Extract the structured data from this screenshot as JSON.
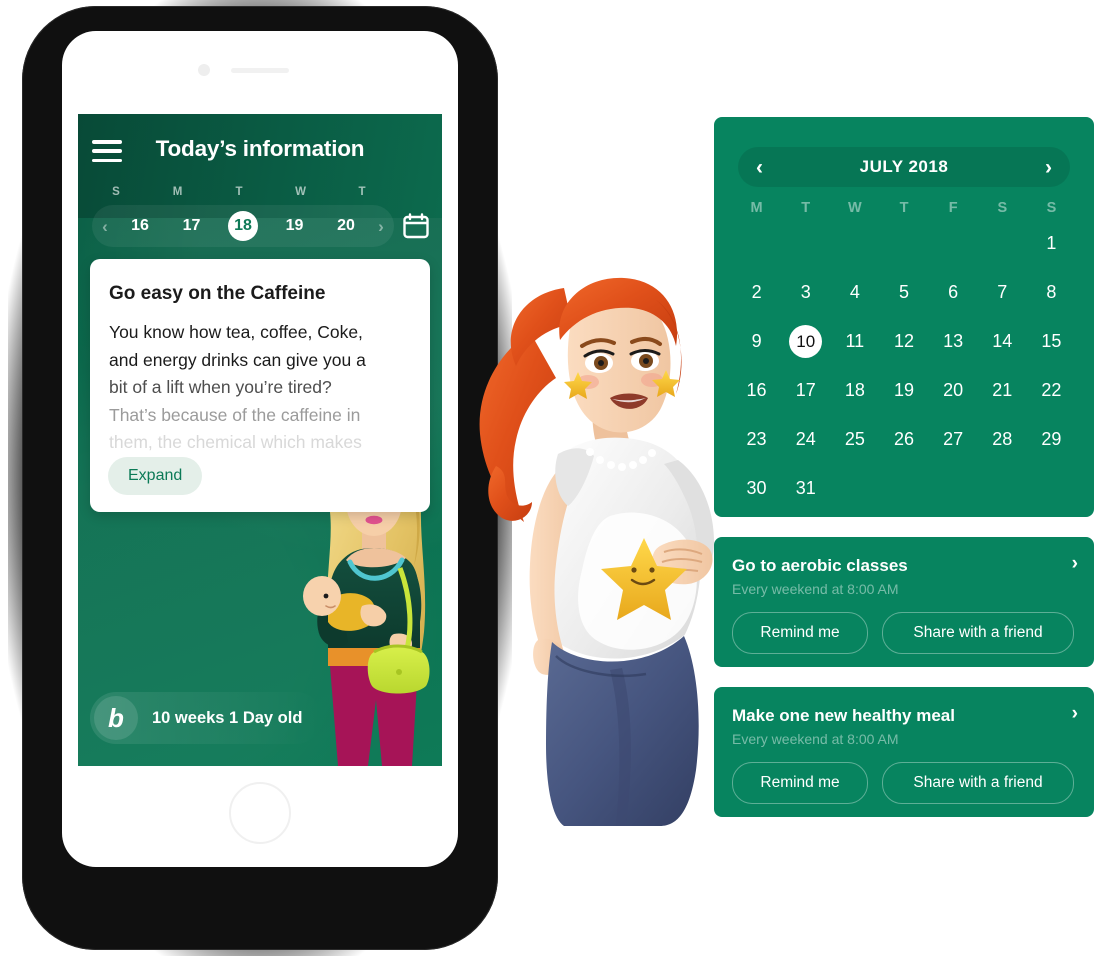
{
  "phone": {
    "app": {
      "header": {
        "menu_icon": "hamburger-menu-icon",
        "title": "Today’s information",
        "calendar_icon": "calendar-icon",
        "prev_icon": "‹",
        "next_icon": "›"
      },
      "date_strip": {
        "weekday_labels": [
          "S",
          "M",
          "T",
          "W",
          "T"
        ],
        "days": [
          "16",
          "17",
          "18",
          "19",
          "20"
        ],
        "selected_day": "18"
      },
      "tip_card": {
        "title": "Go easy on the Caffeine",
        "lines": [
          "You know how tea, coffee, Coke,",
          "and energy drinks can give you a",
          "bit of a lift when you’re tired?",
          "That’s because of the caffeine in",
          "them, the chemical which makes"
        ],
        "expand_label": "Expand"
      },
      "age_badge": {
        "logo_letter": "b",
        "text": "10 weeks 1 Day old"
      }
    }
  },
  "calendar_panel": {
    "prev_icon": "‹",
    "next_icon": "›",
    "month_label": "JULY 2018",
    "weekday_labels": [
      "M",
      "T",
      "W",
      "T",
      "F",
      "S",
      "S"
    ],
    "leading_blanks": 6,
    "days": [
      "1",
      "2",
      "3",
      "4",
      "5",
      "6",
      "7",
      "8",
      "9",
      "10",
      "11",
      "12",
      "13",
      "14",
      "15",
      "16",
      "17",
      "18",
      "19",
      "20",
      "21",
      "22",
      "23",
      "24",
      "25",
      "26",
      "27",
      "28",
      "29",
      "30",
      "31"
    ],
    "selected_day": "10"
  },
  "tasks": [
    {
      "title": "Go to aerobic classes",
      "schedule": "Every weekend at 8:00 AM",
      "chevron_icon": "›",
      "remind_label": "Remind me",
      "share_label": "Share with a friend"
    },
    {
      "title": "Make one new healthy meal",
      "schedule": "Every weekend at 8:00 AM",
      "chevron_icon": "›",
      "remind_label": "Remind me",
      "share_label": "Share with a friend"
    }
  ],
  "colors": {
    "brand_green": "#07845f",
    "header_green": "#0a5c44",
    "screen_green": "#0e7a57",
    "expand_bg": "#e4efe9",
    "expand_text": "#0b7a57",
    "white": "#ffffff"
  }
}
